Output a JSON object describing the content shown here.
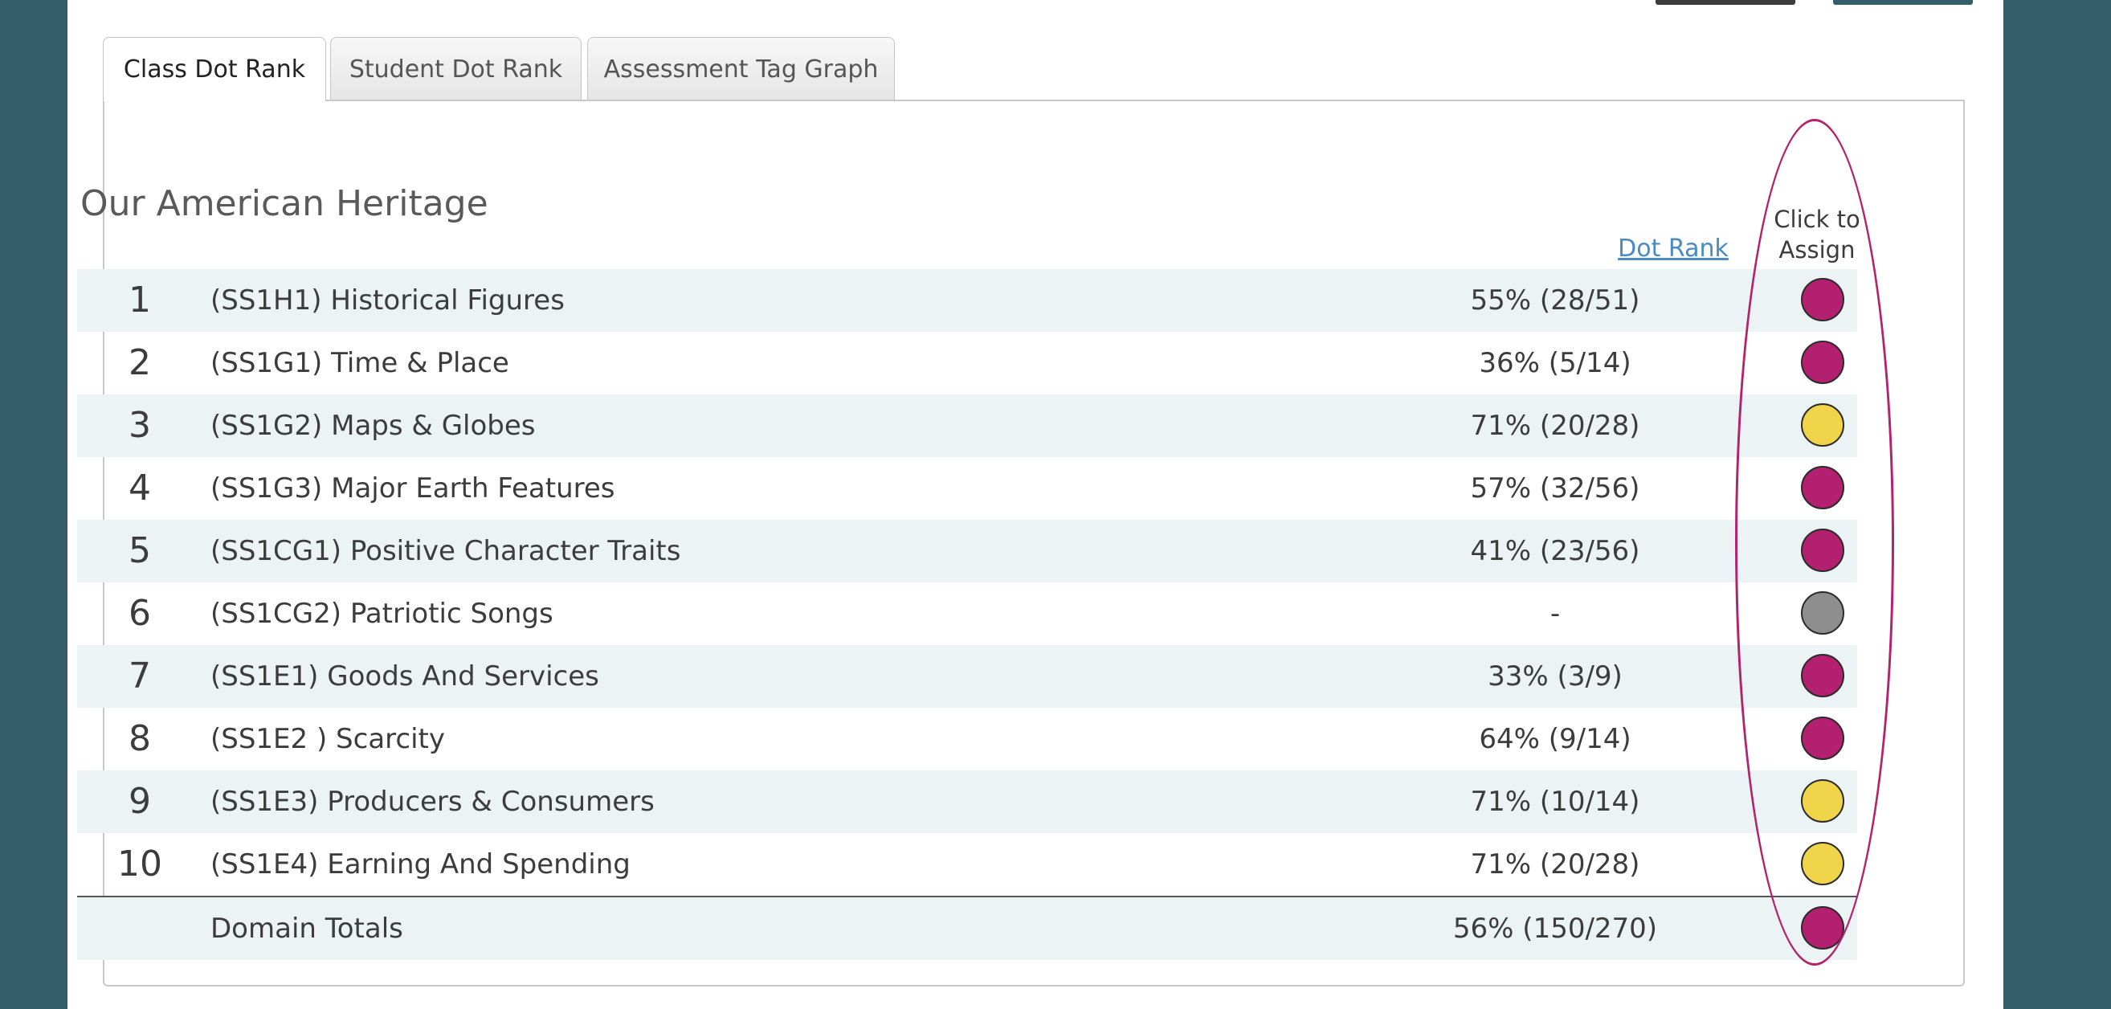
{
  "colors": {
    "low": "#b3206f",
    "mid": "#f0d44a",
    "none": "#8e8e8e",
    "outline": "#b3236d",
    "background": "#355e6b"
  },
  "tabs": [
    "Class Dot Rank",
    "Student Dot Rank",
    "Assessment Tag Graph"
  ],
  "domain_title": "Our American Heritage",
  "dot_rank_link": "Dot Rank",
  "assign_header": "Click to Assign",
  "rows": [
    {
      "rank": "1",
      "name": "(SS1H1) Historical Figures",
      "score": "55% (28/51)",
      "dot": "low"
    },
    {
      "rank": "2",
      "name": "(SS1G1) Time & Place",
      "score": "36% (5/14)",
      "dot": "low"
    },
    {
      "rank": "3",
      "name": "(SS1G2) Maps & Globes",
      "score": "71% (20/28)",
      "dot": "mid"
    },
    {
      "rank": "4",
      "name": "(SS1G3) Major Earth Features",
      "score": "57% (32/56)",
      "dot": "low"
    },
    {
      "rank": "5",
      "name": "(SS1CG1) Positive Character Traits",
      "score": "41% (23/56)",
      "dot": "low"
    },
    {
      "rank": "6",
      "name": "(SS1CG2) Patriotic Songs",
      "score": "-",
      "dot": "none"
    },
    {
      "rank": "7",
      "name": "(SS1E1) Goods And Services",
      "score": "33% (3/9)",
      "dot": "low"
    },
    {
      "rank": "8",
      "name": "(SS1E2 ) Scarcity",
      "score": "64% (9/14)",
      "dot": "low"
    },
    {
      "rank": "9",
      "name": "(SS1E3) Producers & Consumers",
      "score": "71% (10/14)",
      "dot": "mid"
    },
    {
      "rank": "10",
      "name": "(SS1E4) Earning And Spending",
      "score": "71% (20/28)",
      "dot": "mid"
    }
  ],
  "totals": {
    "label": "Domain Totals",
    "score": "56% (150/270)",
    "dot": "low"
  }
}
